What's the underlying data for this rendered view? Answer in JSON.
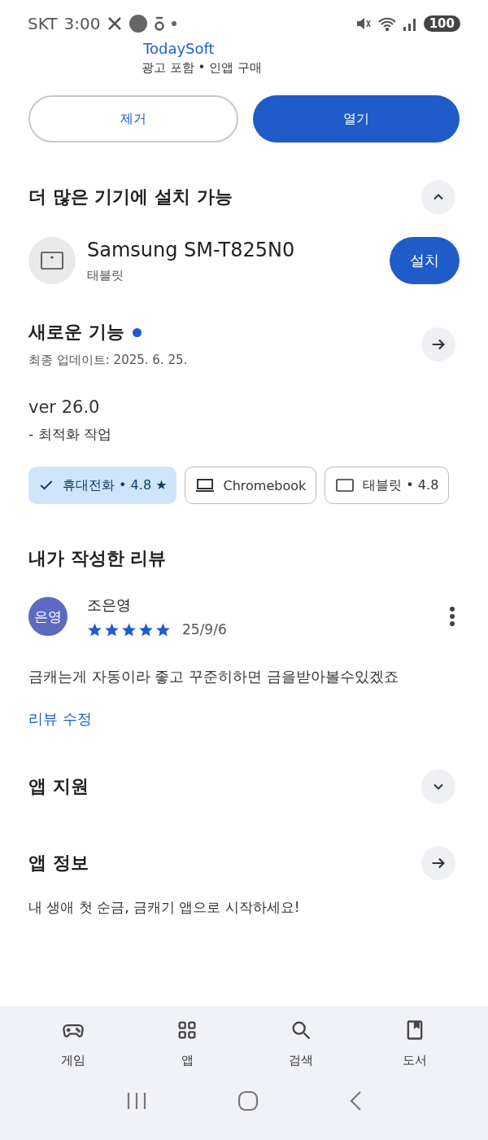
{
  "status_bar": {
    "carrier": "SKT",
    "time": "3:00",
    "battery": "100"
  },
  "app_header": {
    "developer": "TodaySoft",
    "notes": "광고 포함 • 인앱 구매"
  },
  "actions": [
    {
      "label": "제거",
      "kind": "outline"
    },
    {
      "label": "열기",
      "kind": "filled"
    }
  ],
  "devices_section": {
    "title": "더 많은 기기에 설치 가능",
    "expanded": true,
    "devices": [
      {
        "name": "Samsung SM-T825N0",
        "type": "태블릿",
        "button": "설치"
      }
    ]
  },
  "whats_new": {
    "title": "새로운 기능",
    "new_dot": true,
    "updated": "최종 업데이트: 2025. 6. 25.",
    "version": "ver 26.0",
    "notes": "- 최적화 작업"
  },
  "device_chips": [
    {
      "label": "휴대전화 • 4.8 ★",
      "kind": "phone",
      "selected": true
    },
    {
      "label": "Chromebook",
      "kind": "laptop",
      "selected": false
    },
    {
      "label": "태블릿 • 4.8",
      "kind": "tablet",
      "selected": false
    }
  ],
  "my_review": {
    "title": "내가 작성한 리뷰",
    "avatar": "은영",
    "author": "조은영",
    "stars": 5,
    "date": "25/9/6",
    "text": "금캐는게 자동이라 좋고 꾸준히하면 금을받아볼수있겠죠",
    "edit_link": "리뷰 수정"
  },
  "app_support": {
    "title": "앱 지원",
    "expanded": false
  },
  "app_info": {
    "title": "앱 정보",
    "description": "내 생애 첫 순금, 금캐기 앱으로 시작하세요!"
  },
  "bottom_nav": [
    {
      "label": "게임",
      "kind": "games"
    },
    {
      "label": "앱",
      "kind": "apps"
    },
    {
      "label": "검색",
      "kind": "search"
    },
    {
      "label": "도서",
      "kind": "books"
    }
  ]
}
